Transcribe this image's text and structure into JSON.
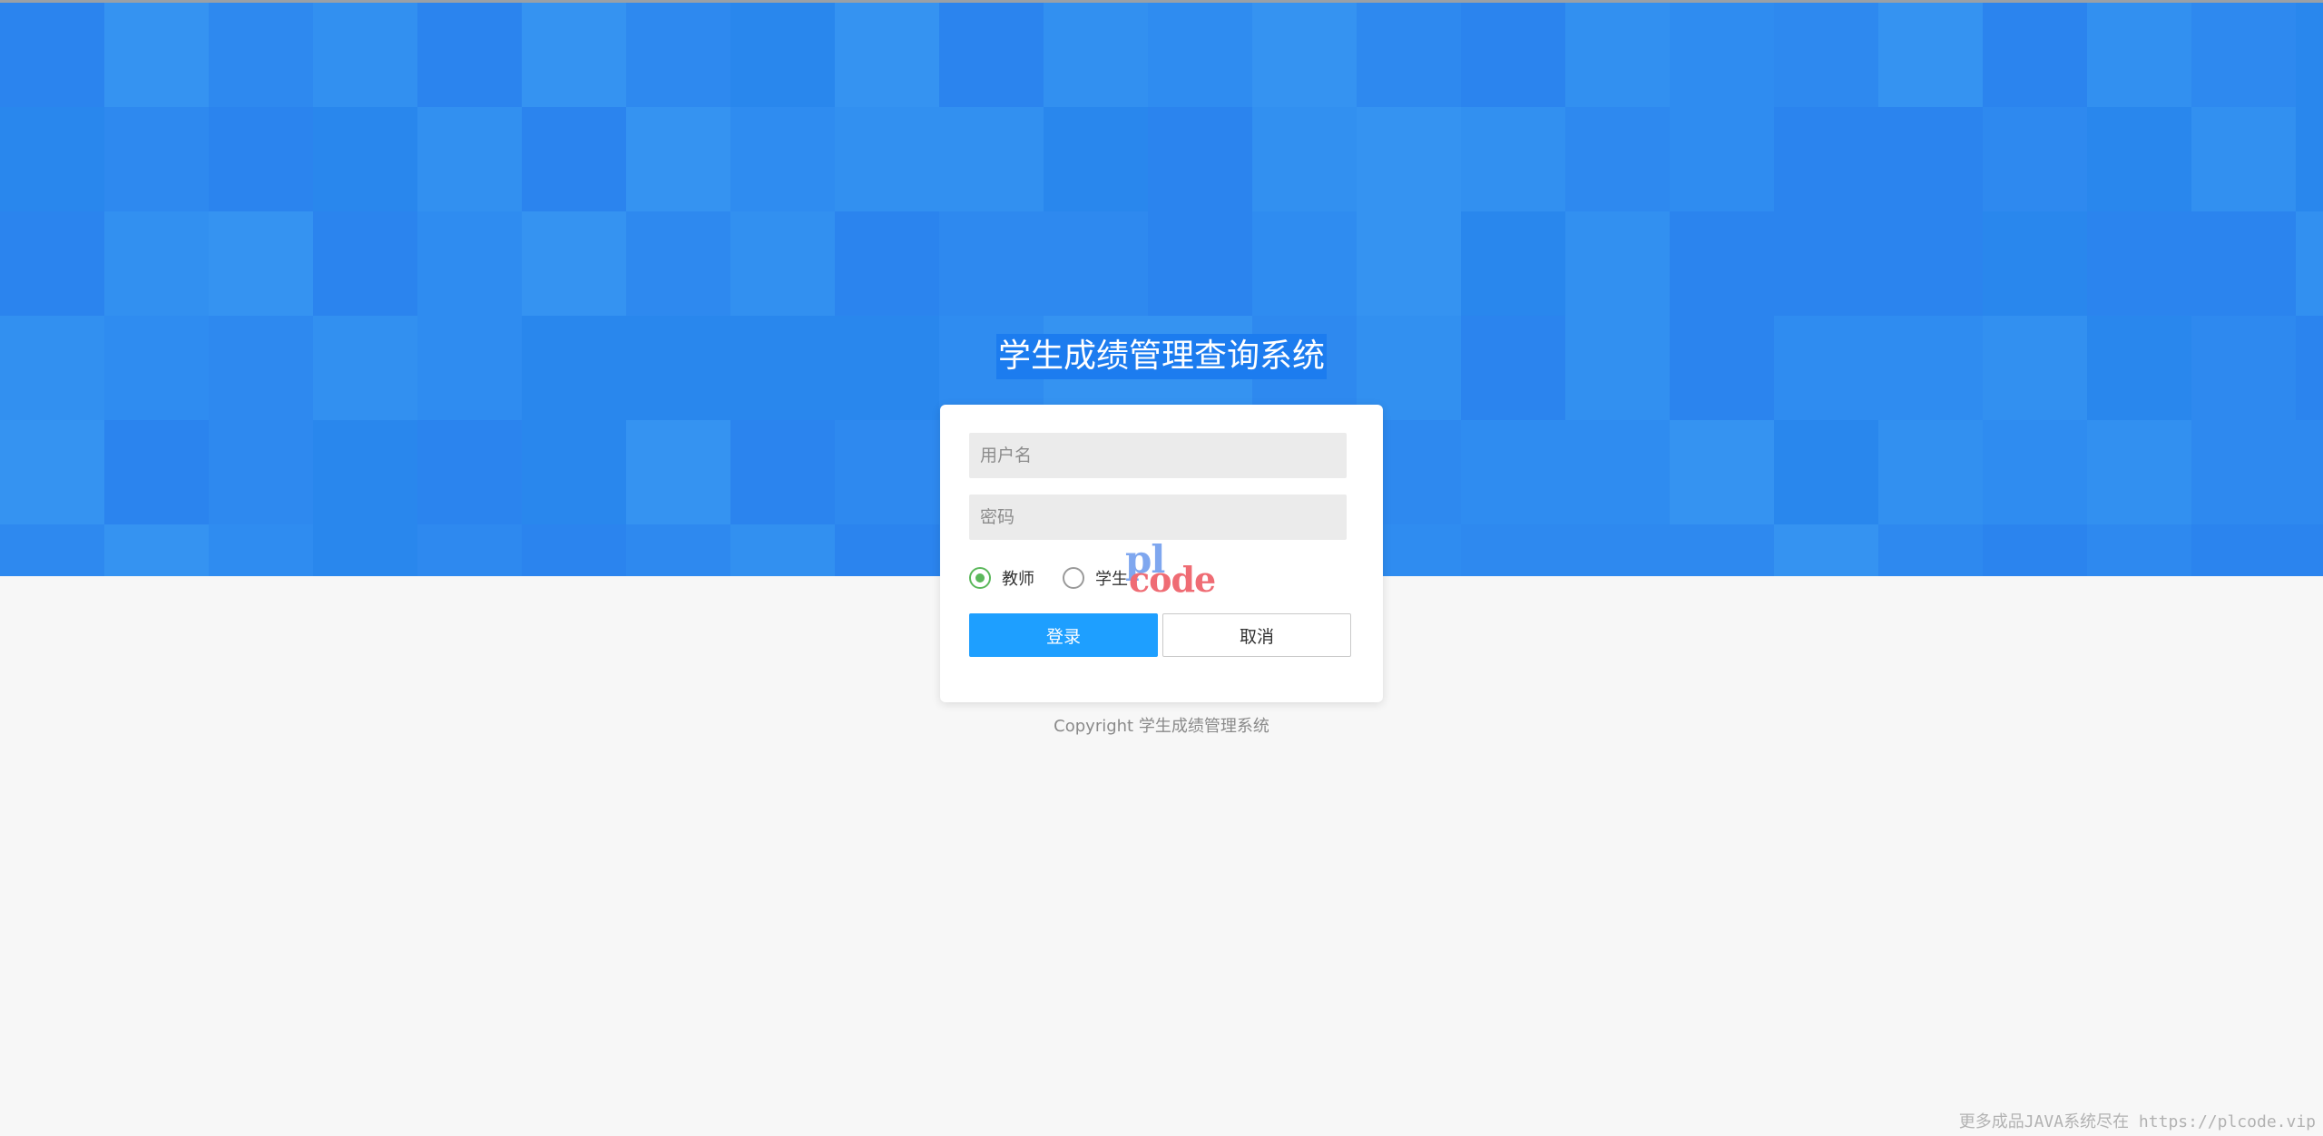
{
  "page": {
    "title": "学生成绩管理查询系统",
    "copyright": "Copyright 学生成绩管理系统",
    "watermark": "更多成品JAVA系统尽在 https://plcode.vip"
  },
  "colors": {
    "hero": "#2f8cf0",
    "title_highlight": "#1c7cef",
    "primary": "#1e9fff",
    "radio_checked": "#5cb85c"
  },
  "login": {
    "username_placeholder": "用户名",
    "password_placeholder": "密码",
    "role_options": [
      {
        "label": "教师",
        "selected": true
      },
      {
        "label": "学生",
        "selected": false
      }
    ],
    "login_label": "登录",
    "cancel_label": "取消"
  },
  "logo": {
    "text_top": "pl",
    "text_bottom": "code"
  }
}
